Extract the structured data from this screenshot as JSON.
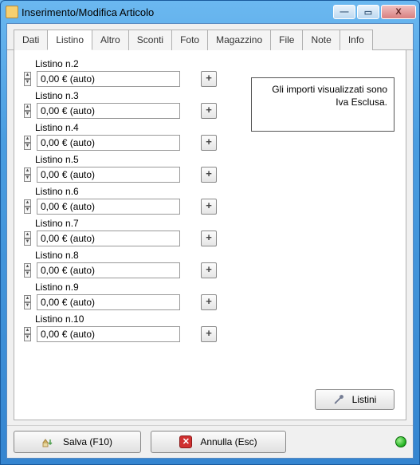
{
  "window": {
    "title": "Inserimento/Modifica Articolo"
  },
  "tabs": [
    {
      "label": "Dati"
    },
    {
      "label": "Listino"
    },
    {
      "label": "Altro"
    },
    {
      "label": "Sconti"
    },
    {
      "label": "Foto"
    },
    {
      "label": "Magazzino"
    },
    {
      "label": "File"
    },
    {
      "label": "Note"
    },
    {
      "label": "Info"
    }
  ],
  "active_tab": "Listino",
  "info_box": "Gli importi visualizzati sono Iva Esclusa.",
  "listini": [
    {
      "label": "Listino n.2",
      "value": "0,00 € (auto)"
    },
    {
      "label": "Listino n.3",
      "value": "0,00 € (auto)"
    },
    {
      "label": "Listino n.4",
      "value": "0,00 € (auto)"
    },
    {
      "label": "Listino n.5",
      "value": "0,00 € (auto)"
    },
    {
      "label": "Listino n.6",
      "value": "0,00 € (auto)"
    },
    {
      "label": "Listino n.7",
      "value": "0,00 € (auto)"
    },
    {
      "label": "Listino n.8",
      "value": "0,00 € (auto)"
    },
    {
      "label": "Listino n.9",
      "value": "0,00 € (auto)"
    },
    {
      "label": "Listino n.10",
      "value": "0,00 € (auto)"
    }
  ],
  "plus_label": "+",
  "listini_button": "Listini",
  "footer": {
    "save": "Salva (F10)",
    "cancel": "Annulla (Esc)"
  }
}
